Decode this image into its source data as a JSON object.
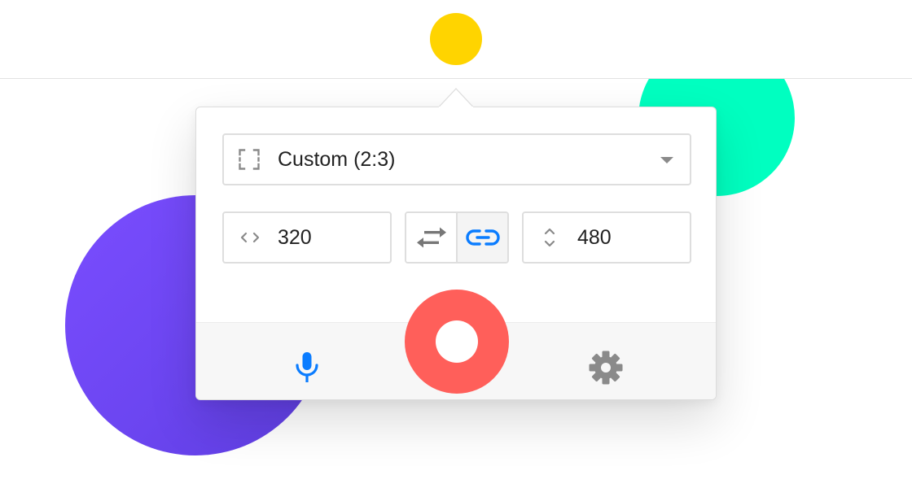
{
  "menubar": {
    "tray_icon": "record-tray-icon",
    "tray_color": "#FFD400"
  },
  "background": {
    "shapes": [
      "green-circle",
      "purple-circle"
    ],
    "colors": {
      "green": "#00FFC0",
      "purple": "#7A4DFF"
    }
  },
  "popover": {
    "preset": {
      "icon": "frame-corners-icon",
      "label": "Custom (2:3)",
      "dropdown_icon": "caret-down-icon"
    },
    "width": {
      "icon": "horizontal-arrows-icon",
      "value": "320"
    },
    "height": {
      "icon": "vertical-arrows-icon",
      "value": "480"
    },
    "controls": {
      "swap_icon": "swap-arrows-icon",
      "link_icon": "link-icon",
      "link_active": true
    },
    "footer": {
      "mic_icon": "microphone-icon",
      "record_icon": "record-icon",
      "settings_icon": "gear-icon"
    }
  },
  "colors": {
    "accent": "#0A7CFF",
    "record": "#FF5F5A",
    "icon_gray": "#8a8a8a",
    "text": "#222222"
  }
}
